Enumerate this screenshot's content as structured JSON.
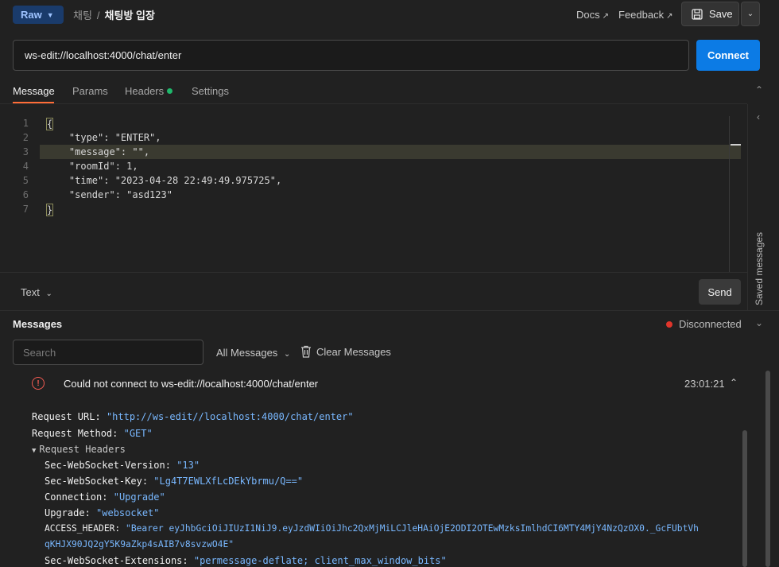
{
  "topbar": {
    "mode": "Raw",
    "breadcrumb_parent": "채팅",
    "breadcrumb_current": "채팅방 입장",
    "docs": "Docs",
    "feedback": "Feedback",
    "save": "Save"
  },
  "url": {
    "value": "ws-edit://localhost:4000/chat/enter",
    "connect": "Connect"
  },
  "tabs": [
    "Message",
    "Params",
    "Headers",
    "Settings"
  ],
  "editor": {
    "line_numbers": [
      "1",
      "2",
      "3",
      "4",
      "5",
      "6",
      "7"
    ],
    "lines": [
      "{",
      "    \"type\": \"ENTER\",",
      "    \"message\": \"\",",
      "    \"roomId\": 1,",
      "    \"time\": \"2023-04-28 22:49:49.975725\",",
      "    \"sender\": \"asd123\"",
      "}"
    ],
    "format": "Text",
    "send": "Send"
  },
  "side_panel": {
    "label": "Saved messages"
  },
  "messages": {
    "title": "Messages",
    "status": "Disconnected",
    "search_placeholder": "Search",
    "filter": "All Messages",
    "clear": "Clear Messages",
    "error": {
      "text": "Could not connect to ws-edit://localhost:4000/chat/enter",
      "time": "23:01:21"
    },
    "request_url_key": "Request URL:",
    "request_url_val": "\"http://ws-edit//localhost:4000/chat/enter\"",
    "request_method_key": "Request Method:",
    "request_method_val": "\"GET\"",
    "request_headers": "Request Headers",
    "headers": [
      {
        "key": "Sec-WebSocket-Version:",
        "value": "\"13\""
      },
      {
        "key": "Sec-WebSocket-Key:",
        "value": "\"Lg4T7EWLXfLcDEkYbrmu/Q==\""
      },
      {
        "key": "Connection:",
        "value": "\"Upgrade\""
      },
      {
        "key": "Upgrade:",
        "value": "\"websocket\""
      },
      {
        "key": "ACCESS_HEADER:",
        "value": "\"Bearer eyJhbGciOiJIUzI1NiJ9.eyJzdWIiOiJhc2QxMjMiLCJleHAiOjE2ODI2OTEwMzksImlhdCI6MTY4MjY4NzQzOX0._GcFUbtVh",
        "value_cont": "qKHJX90JQ2gY5K9aZkp4sAIB7v8svzwO4E\""
      },
      {
        "key": "Sec-WebSocket-Extensions:",
        "value": "\"permessage-deflate; client_max_window_bits\""
      }
    ]
  }
}
